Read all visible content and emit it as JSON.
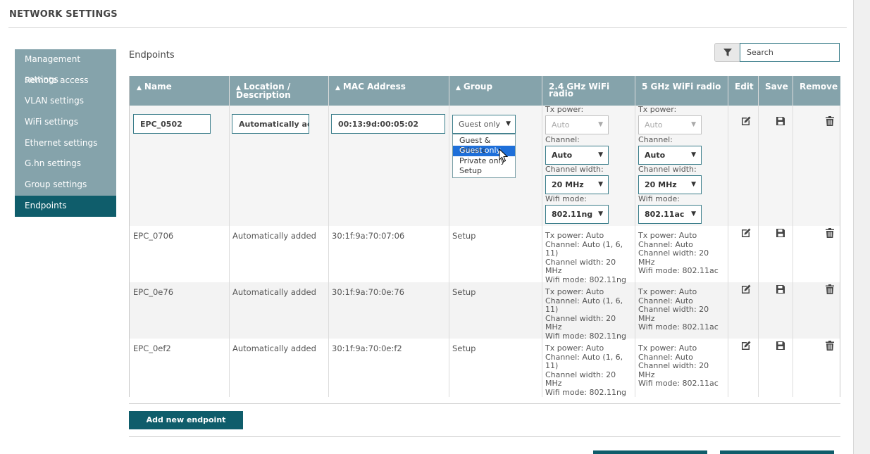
{
  "page": {
    "title": "NETWORK SETTINGS"
  },
  "sidebar": {
    "items": [
      {
        "label": "Management settings"
      },
      {
        "label": "Remote access"
      },
      {
        "label": "VLAN settings"
      },
      {
        "label": "WiFi settings"
      },
      {
        "label": "Ethernet settings"
      },
      {
        "label": "G.hn settings"
      },
      {
        "label": "Group settings"
      },
      {
        "label": "Endpoints",
        "active": true
      }
    ]
  },
  "section": {
    "title": "Endpoints"
  },
  "search": {
    "placeholder": "Search",
    "value": ""
  },
  "table": {
    "headers": {
      "name": "Name",
      "location": "Location / Description",
      "mac": "MAC Address",
      "group": "Group",
      "radio24": "2.4 GHz WiFi radio",
      "radio5": "5 GHz WiFi radio",
      "edit": "Edit",
      "save": "Save",
      "remove": "Remove"
    },
    "edit_row": {
      "name": "EPC_0502",
      "location": "Automatically added",
      "mac": "00:13:9d:00:05:02",
      "group_value": "Guest only",
      "group_options": [
        "Guest & Private",
        "Guest only",
        "Private only",
        "Setup"
      ],
      "labels": {
        "tx": "Tx power:",
        "channel": "Channel:",
        "width": "Channel width:",
        "mode": "Wifi mode:"
      },
      "radio24": {
        "tx": "Auto",
        "channel": "Auto",
        "width": "20 MHz",
        "mode": "802.11ng"
      },
      "radio5": {
        "tx": "Auto",
        "channel": "Auto",
        "width": "20 MHz",
        "mode": "802.11ac"
      }
    },
    "rows": [
      {
        "name": "EPC_0706",
        "location": "Automatically added",
        "mac": "30:1f:9a:70:07:06",
        "group": "Setup",
        "radio24": "Tx power: Auto\nChannel: Auto (1, 6, 11)\nChannel width: 20 MHz\nWifi mode: 802.11ng",
        "radio5": "Tx power: Auto\nChannel: Auto\nChannel width: 20 MHz\nWifi mode: 802.11ac"
      },
      {
        "name": "EPC_0e76",
        "location": "Automatically added",
        "mac": "30:1f:9a:70:0e:76",
        "group": "Setup",
        "radio24": "Tx power: Auto\nChannel: Auto (1, 6, 11)\nChannel width: 20 MHz\nWifi mode: 802.11ng",
        "radio5": "Tx power: Auto\nChannel: Auto\nChannel width: 20 MHz\nWifi mode: 802.11ac"
      },
      {
        "name": "EPC_0ef2",
        "location": "Automatically added",
        "mac": "30:1f:9a:70:0e:f2",
        "group": "Setup",
        "radio24": "Tx power: Auto\nChannel: Auto (1, 6, 11)\nChannel width: 20 MHz\nWifi mode: 802.11ng",
        "radio5": "Tx power: Auto\nChannel: Auto\nChannel width: 20 MHz\nWifi mode: 802.11ac"
      }
    ]
  },
  "actions": {
    "add_label": "Add new endpoint"
  },
  "icons": {
    "filter": "filter-icon",
    "edit": "edit-icon",
    "save": "save-icon",
    "remove": "trash-icon"
  },
  "colors": {
    "header": "#85a3ab",
    "accent": "#0f5d6b",
    "selected_option": "#1e6fd9"
  }
}
